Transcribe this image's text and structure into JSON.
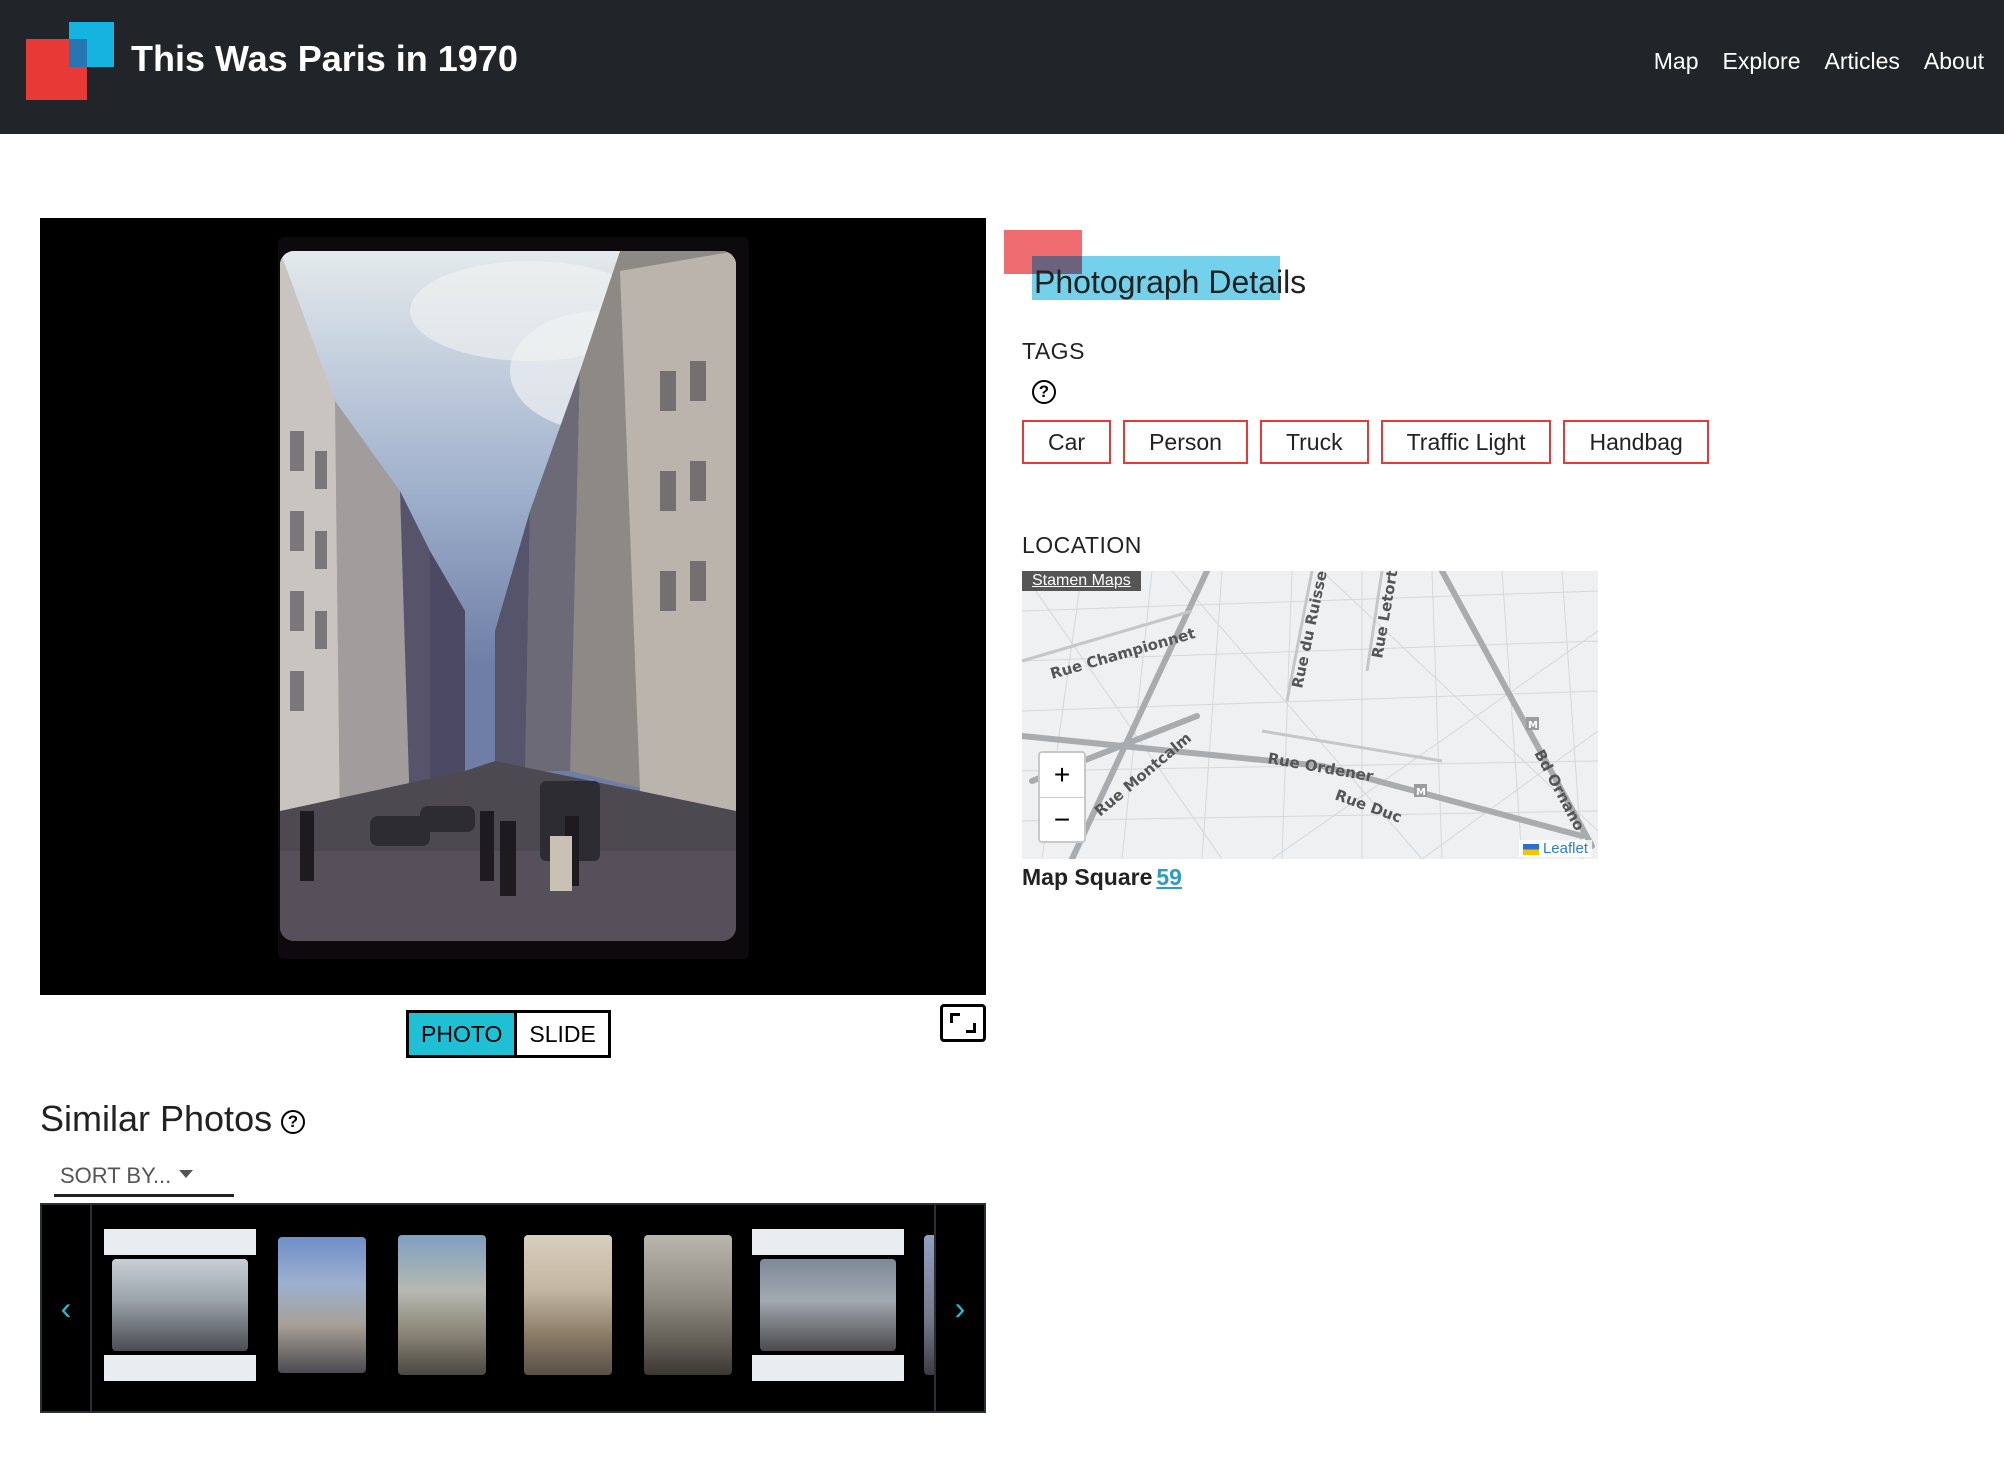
{
  "header": {
    "site_title": "This Was Paris in 1970",
    "nav": [
      "Map",
      "Explore",
      "Articles",
      "About"
    ]
  },
  "viewer": {
    "toggle": {
      "photo": "PHOTO",
      "slide": "SLIDE",
      "active": "PHOTO"
    }
  },
  "similar": {
    "title": "Similar Photos",
    "help_glyph": "?",
    "sort_label": "SORT BY...",
    "prev_arrow": "‹",
    "next_arrow": "›"
  },
  "details": {
    "title": "Photograph Details",
    "tags_label": "TAGS",
    "tags_help_glyph": "?",
    "tags": [
      "Car",
      "Person",
      "Truck",
      "Traffic Light",
      "Handbag"
    ],
    "location_label": "LOCATION",
    "map": {
      "attribution_top": "Stamen Maps",
      "zoom_in": "+",
      "zoom_out": "−",
      "leaflet": "Leaflet",
      "streets": [
        "Rue Championnet",
        "Rue du Ruisseau",
        "Rue Letort",
        "Rue Montcalm",
        "Rue Ordener",
        "Rue Duc",
        "Bd Ornano"
      ],
      "metro_glyph": "M"
    },
    "map_square_label": "Map Square",
    "map_square_value": "59"
  },
  "colors": {
    "header_bg": "#212529",
    "brand_red": "#e73a36",
    "brand_blue": "#15b3df",
    "accent_cyan": "#1fbfd4",
    "link_blue": "#2e9bc4"
  }
}
